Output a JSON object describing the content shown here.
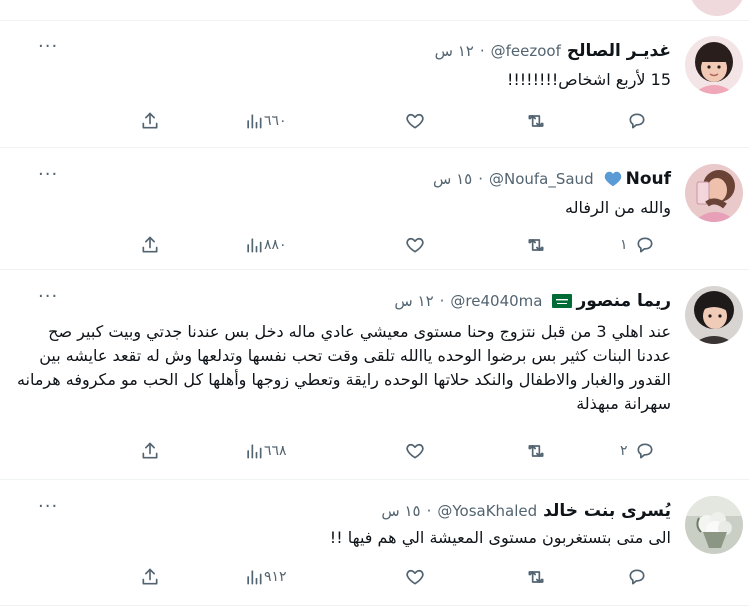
{
  "tweets": [
    {
      "name": "غديـر الصالح",
      "handle": "@feezoof",
      "time": "١٢ س",
      "text": "15 لأربع اشخاص!!!!!!!!",
      "views": "٦٦٠",
      "replies": "",
      "badge": ""
    },
    {
      "name": "Nouf",
      "handle": "@Noufa_Saud",
      "time": "١٥ س",
      "text": "والله من الرفاله",
      "views": "٨٨٠",
      "replies": "١",
      "badge": "blue-heart-emoji"
    },
    {
      "name": "ريما منصور",
      "handle": "@re4040ma",
      "time": "١٢ س",
      "text": "عند اهلي 3 من قبل نتزوج وحنا مستوى معيشي عادي ماله دخل بس عندنا جدتي وبيت كبير صح عددنا البنات كثير بس برضوا الوحده ياالله تلقى وقت تحب نفسها وتدلعها وش له تقعد عايشه بين القدور والغبار والاطفال والنكد حلاتها الوحده رايقة وتعطي زوجها وأهلها كل الحب مو مكروفه هرمانه سهرانة مبهذلة",
      "views": "٦٦٨",
      "replies": "٢",
      "badge": "saudi-flag-emoji"
    },
    {
      "name": "يُسرى بنت خالد",
      "handle": "@YosaKhaled",
      "time": "١٥ س",
      "text": "الى متى بتستغربون مستوى المعيشة الي هم فيها !!",
      "views": "٩١٢",
      "replies": "",
      "badge": ""
    }
  ],
  "separator": "·",
  "more_glyph": "···",
  "colors": {
    "text": "#0f1419",
    "muted": "#536471",
    "divider": "#eff3f4",
    "heart_badge": "#5b9bd5",
    "flag_green": "#006c35"
  }
}
